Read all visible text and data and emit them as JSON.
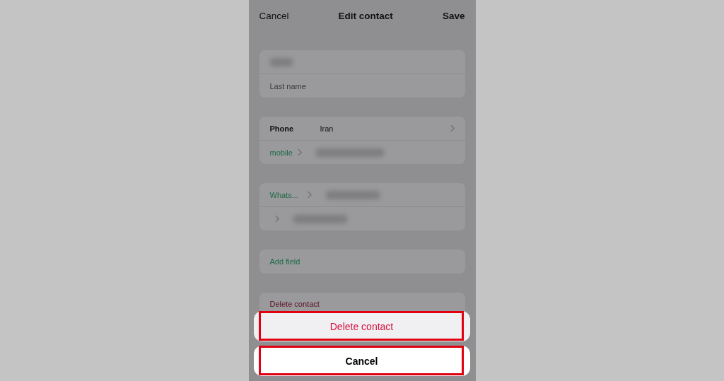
{
  "header": {
    "cancel": "Cancel",
    "title": "Edit contact",
    "save": "Save"
  },
  "name_card": {
    "rows": [
      {
        "kind": "blurred"
      },
      {
        "kind": "input",
        "placeholder": "Last name"
      }
    ]
  },
  "phone_card": {
    "label": "Phone",
    "country": "Iran",
    "type": "mobile"
  },
  "whatsapp_card": {
    "rows": [
      {
        "kind": "labeled",
        "label": "Whats..."
      },
      {
        "kind": "unlabeled"
      }
    ]
  },
  "add_field": "Add field",
  "delete_contact": "Delete contact",
  "action_sheet": {
    "buttons": [
      {
        "label": "Delete contact",
        "kind": "destructive",
        "highlighted": true
      },
      {
        "label": "Cancel",
        "kind": "cancel",
        "highlighted": true
      }
    ]
  }
}
